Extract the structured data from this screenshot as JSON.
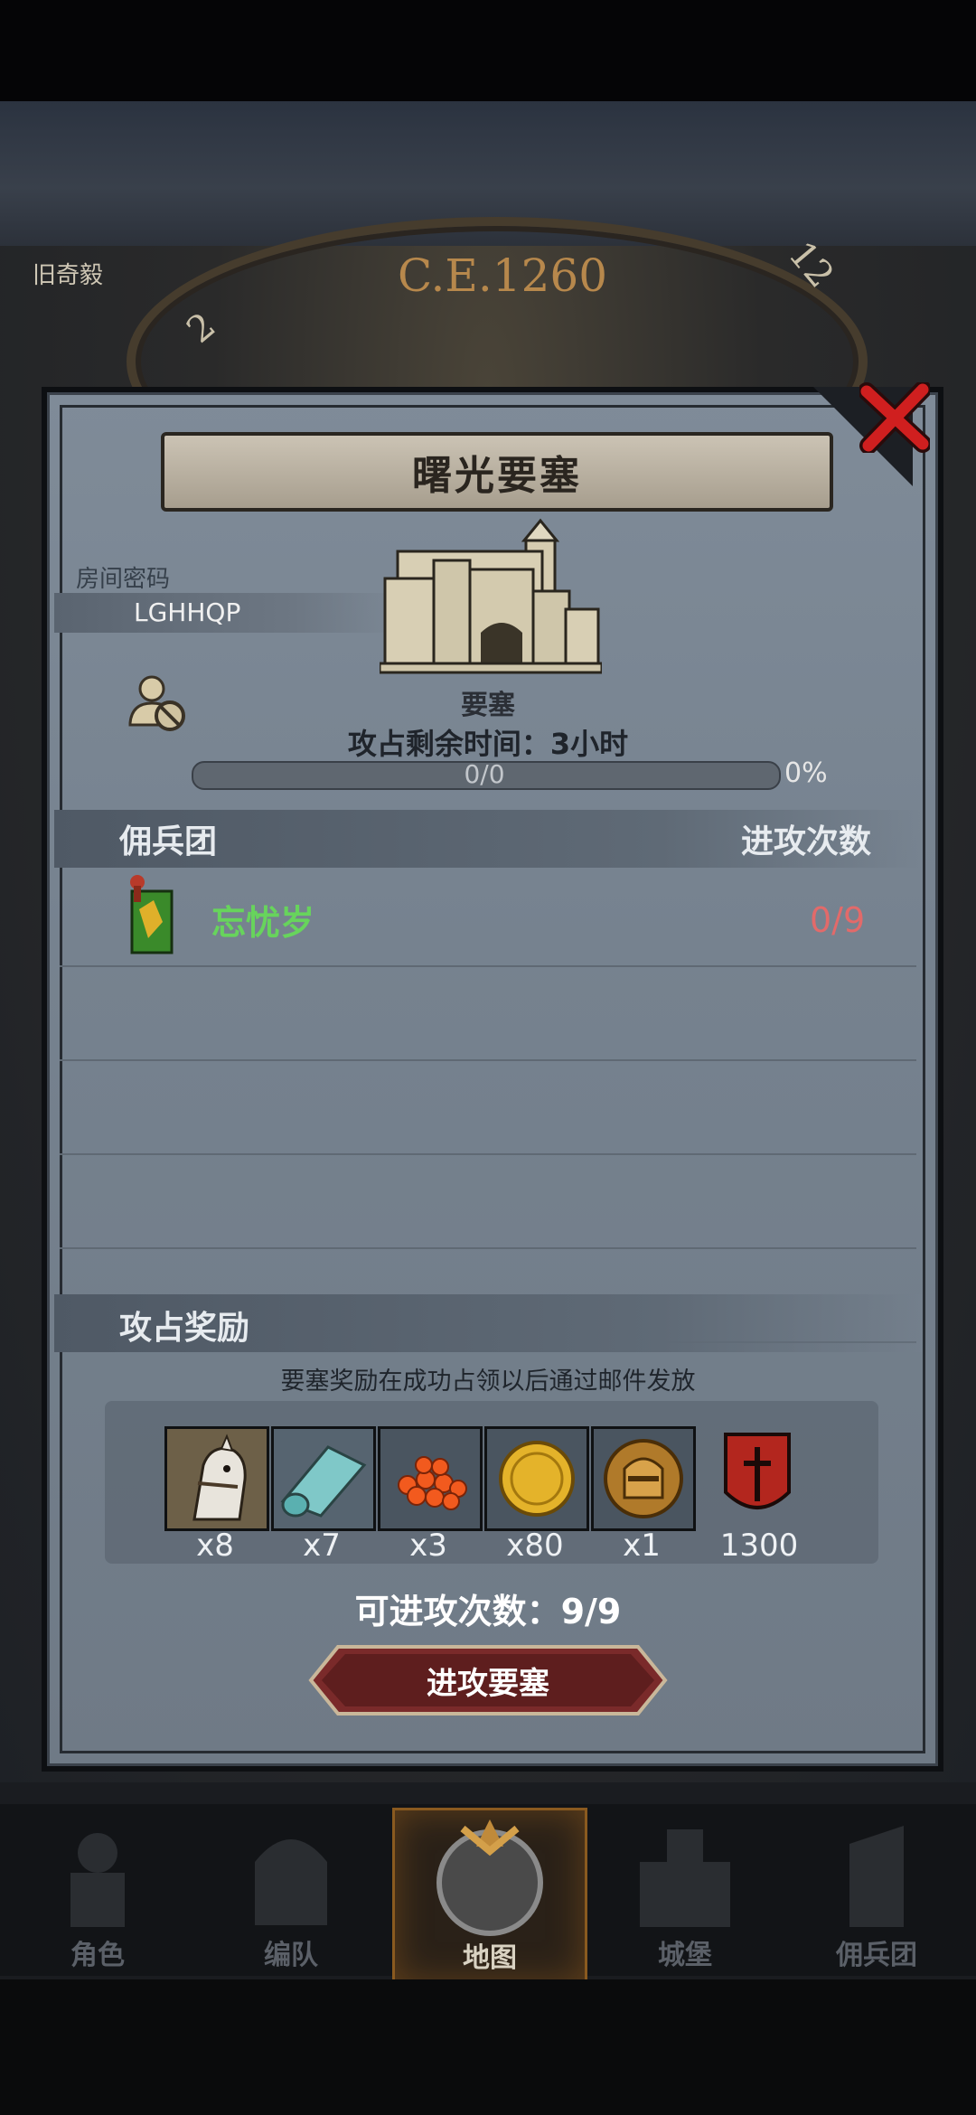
{
  "background": {
    "year_label": "C.E.1260",
    "behind_panel_text": "旧奇毅",
    "clock_numbers": [
      "12",
      "2"
    ]
  },
  "dialog": {
    "title": "曙光要塞",
    "room_password_label": "房间密码",
    "room_code": "LGHHQP",
    "fortress_label": "要塞",
    "time_remaining": "攻占剩余时间：3小时",
    "progress_text": "0/0",
    "progress_percent": "0%",
    "progress_value": 0
  },
  "mercenary_section": {
    "title": "佣兵团",
    "right_header": "进攻次数",
    "rows": [
      {
        "name": "忘忧岁",
        "attacks": "0/9"
      }
    ]
  },
  "reward_section": {
    "title": "攻占奖励",
    "note": "要塞奖励在成功占领以后通过邮件发放",
    "items": [
      {
        "icon": "horse-icon",
        "qty": "x8"
      },
      {
        "icon": "cloth-roll-icon",
        "qty": "x7"
      },
      {
        "icon": "orange-gems-icon",
        "qty": "x3"
      },
      {
        "icon": "gold-coin-icon",
        "qty": "x80"
      },
      {
        "icon": "knight-helmet-coin-icon",
        "qty": "x1"
      },
      {
        "icon": "red-shield-emblem-icon",
        "qty": "1300"
      }
    ]
  },
  "attacks_left": "可进攻次数：9/9",
  "attack_button": "进攻要塞",
  "nav": {
    "items": [
      {
        "label": "角色",
        "active": false
      },
      {
        "label": "编队",
        "active": false
      },
      {
        "label": "地图",
        "active": true
      },
      {
        "label": "城堡",
        "active": false
      },
      {
        "label": "佣兵团",
        "active": false
      }
    ]
  },
  "colors": {
    "panel": "#76828f",
    "merc_name": "#67d45c",
    "attack_count": "#e26a6a",
    "button": "#7a2a2a",
    "close": "#d01f1f"
  }
}
